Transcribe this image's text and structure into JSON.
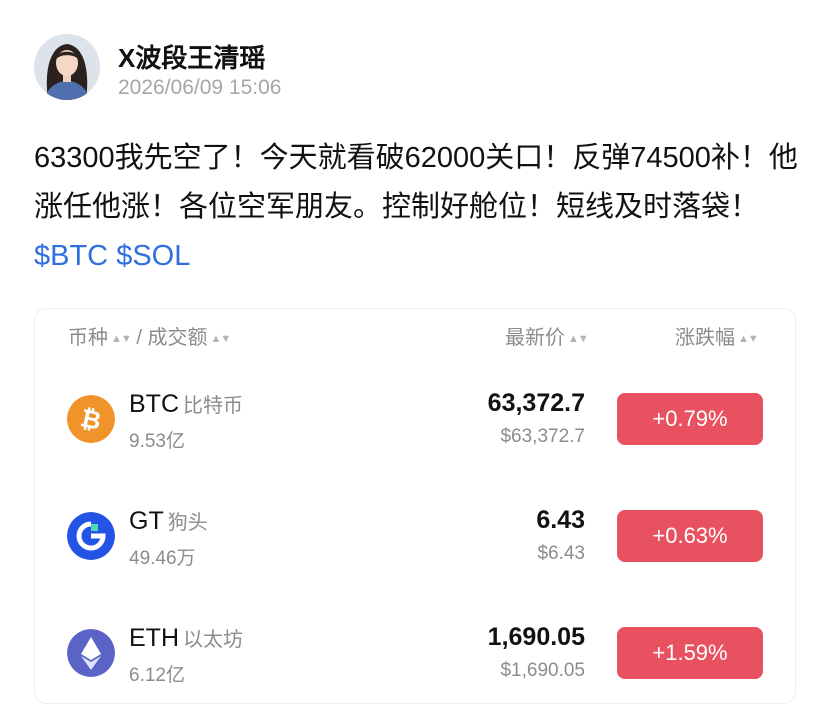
{
  "post": {
    "author": "X波段王清瑶",
    "timestamp": "2026/06/09 15:06",
    "text": "63300我先空了！今天就看破62000关口！反弹74500补！他涨任他涨！各位空军朋友。控制好舱位！短线及时落袋！",
    "tags": [
      "$BTC",
      "$SOL"
    ]
  },
  "market": {
    "headers": {
      "coin": "币种",
      "separator": "/",
      "volume": "成交额",
      "price": "最新价",
      "change": "涨跌幅"
    },
    "rows": [
      {
        "symbol": "BTC",
        "name": "比特币",
        "volume": "9.53亿",
        "price": "63,372.7",
        "usd": "$63,372.7",
        "change": "+0.79%",
        "icon": "bitcoin-icon"
      },
      {
        "symbol": "GT",
        "name": "狗头",
        "volume": "49.46万",
        "price": "6.43",
        "usd": "$6.43",
        "change": "+0.63%",
        "icon": "gatetoken-icon"
      },
      {
        "symbol": "ETH",
        "name": "以太坊",
        "volume": "6.12亿",
        "price": "1,690.05",
        "usd": "$1,690.05",
        "change": "+1.59%",
        "icon": "ethereum-icon"
      }
    ]
  },
  "colors": {
    "change_badge": "#e8515f",
    "tag": "#2f6fe0",
    "bitcoin": "#f0932b",
    "gatetoken": "#2354e6",
    "ethereum": "#5b63c7"
  }
}
